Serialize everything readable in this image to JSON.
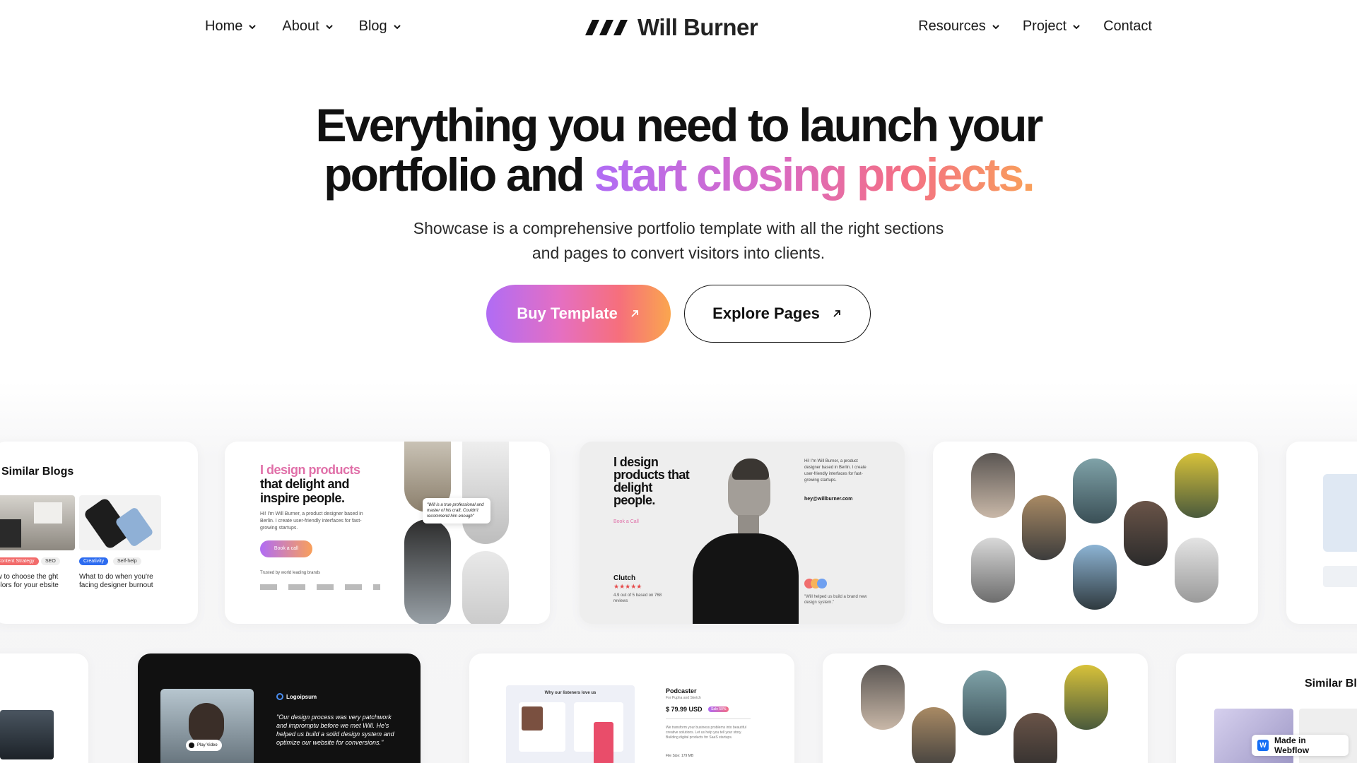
{
  "nav": {
    "left": [
      {
        "label": "Home",
        "has_dropdown": true
      },
      {
        "label": "About",
        "has_dropdown": true
      },
      {
        "label": "Blog",
        "has_dropdown": true
      }
    ],
    "brand": {
      "name": "Will Burner",
      "icon": "slashes-logo-icon"
    },
    "right": [
      {
        "label": "Resources",
        "has_dropdown": true
      },
      {
        "label": "Project",
        "has_dropdown": true
      },
      {
        "label": "Contact",
        "has_dropdown": false
      }
    ]
  },
  "hero": {
    "title_line1": "Everything you need to launch your",
    "title_line2_plain": "portfolio and ",
    "title_line2_gradient": "start closing projects.",
    "subtitle_line1": "Showcase is a comprehensive portfolio template with all the right sections",
    "subtitle_line2": "and pages to convert visitors into clients.",
    "buy_button": "Buy Template",
    "explore_button": "Explore Pages",
    "gradient_colors": [
      "#b06cf5",
      "#e56fc2",
      "#f66f7c",
      "#faa64e"
    ]
  },
  "gallery": {
    "card1": {
      "title": "Similar Blogs",
      "tags_a": [
        "Content Strategy",
        "SEO"
      ],
      "tags_b": [
        "Creativity",
        "Self-help"
      ],
      "post_a": "ow to choose the ght colors for your ebsite",
      "post_b": "What to do when you're facing designer burnout"
    },
    "card2": {
      "headline_gradient": "I design products",
      "headline_rest": "that delight and inspire people.",
      "body": "Hi! I'm Will Burner, a product designer based in Berlin. I create user-friendly interfaces for fast-growing startups.",
      "cta": "Book a call",
      "trusted": "Trusted by world leading brands",
      "quote": "\"Will is a true professional and master of his craft. Couldn't recommend him enough\""
    },
    "card3": {
      "headline": "I design products that delight people.",
      "cta": "Book a Call",
      "intro": "Hi! I'm Will Burner, a product designer based in Berlin. I create user-friendly interfaces for fast-growing startups.",
      "email": "hey@willburner.com",
      "clutch": "Clutch",
      "stars": "★★★★★",
      "rating_text": "4.9 out of 5 based on 768 reviews",
      "testimonial": "\"Will helped us build a brand new design system.\""
    },
    "card5": {
      "brand": "Logoipsum",
      "quote": "\"Our design process was very patchwork and impromptu before we met Will. He's helped us build a solid design system and optimize our website for conversions.\"",
      "play": "Play Video"
    },
    "card6": {
      "heading": "Why our listeners love us",
      "title": "Podcaster",
      "subtitle": "For Pupha and Sketch",
      "price": "$ 79.99 USD",
      "badge": "Sale 50%",
      "desc": "We transform your business problems into beautiful creative solutions. Let us help you tell your story. Building digital products for SaaS startups.",
      "file_size": "File Size: 179 MB"
    },
    "card8": {
      "title": "Similar Blo"
    }
  },
  "badge": {
    "label": "Made in Webflow",
    "logo": "webflow-logo-icon"
  }
}
